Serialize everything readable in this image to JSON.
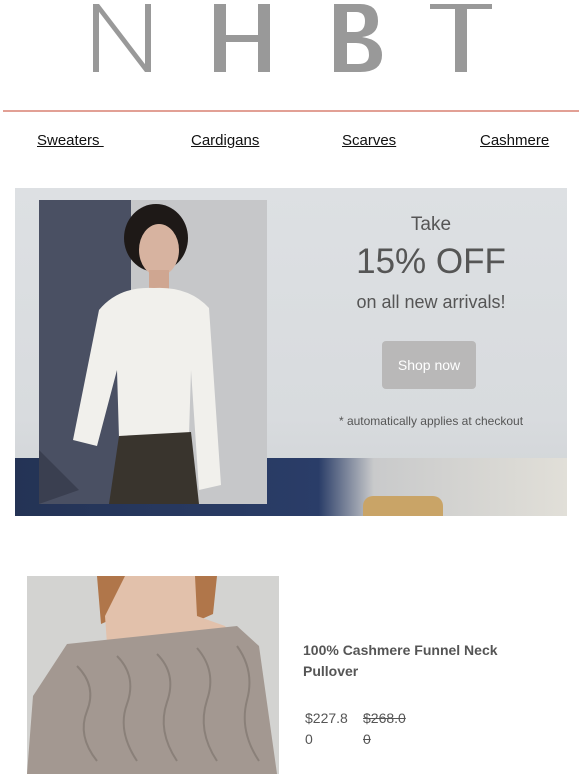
{
  "brand": {
    "logo_text": "NHBT",
    "color": "#999999"
  },
  "nav": {
    "items": [
      {
        "label": "Sweaters "
      },
      {
        "label": "Cardigans"
      },
      {
        "label": "Scarves"
      },
      {
        "label": "Cashmere"
      }
    ]
  },
  "hero": {
    "take": "Take",
    "offer": "15% OFF",
    "subtitle": "on all new arrivals!",
    "cta": "Shop now",
    "note": "* automatically applies at checkout"
  },
  "product": {
    "title": "100% Cashmere Funnel Neck Pullover",
    "price": "$227.80",
    "original_price": "$268.00"
  },
  "colors": {
    "divider": "#e2a095",
    "button": "#b9b8b8",
    "text": "#555555"
  }
}
